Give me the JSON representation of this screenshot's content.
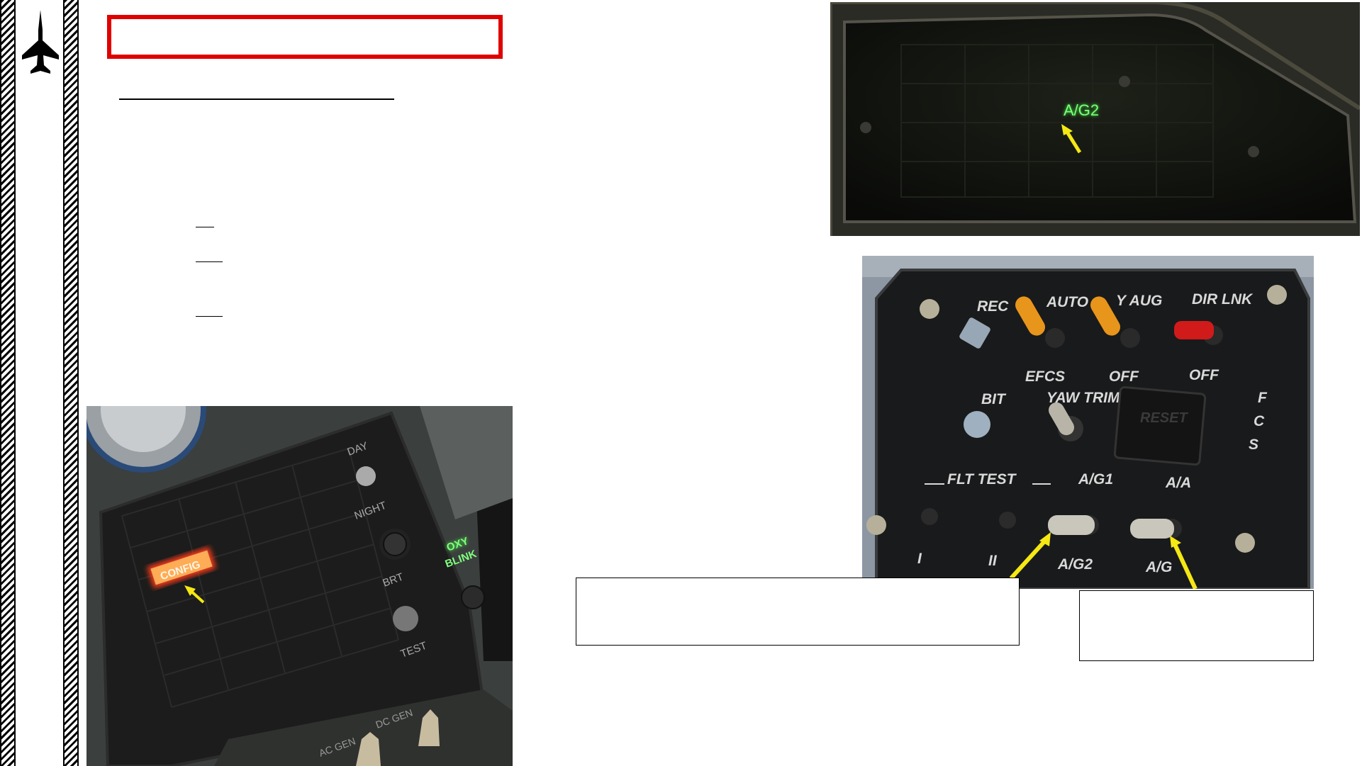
{
  "images": {
    "caution_light_panel": {
      "lit_label": "A/G2"
    },
    "warning_panel": {
      "lit_label": "CONFIG",
      "labels": [
        "DAY",
        "NIGHT",
        "BRT",
        "TEST",
        "OXY",
        "BLINK",
        "AC GEN",
        "DC GEN"
      ]
    },
    "fcs_panel": {
      "labels": [
        "REC",
        "AUTO",
        "Y AUG",
        "DIR LNK",
        "EFCS",
        "OFF",
        "OFF",
        "BIT",
        "YAW TRIM",
        "RESET",
        "F",
        "C",
        "S",
        "FLT TEST",
        "A/G1",
        "A/A",
        "I",
        "II",
        "A/G2",
        "A/G"
      ]
    }
  },
  "colors": {
    "title_box_border": "#e00000",
    "arrow": "#f5e814",
    "green_light": "#3cff3c",
    "red_light": "#ff3a1a"
  }
}
